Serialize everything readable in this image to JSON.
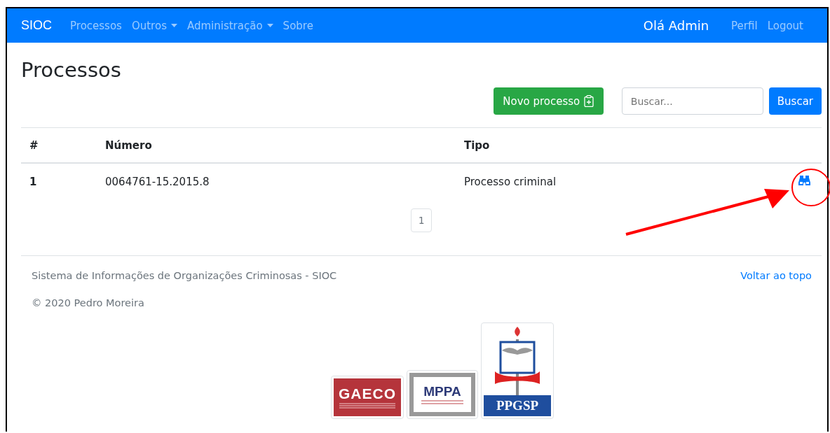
{
  "navbar": {
    "brand": "SIOC",
    "links": [
      {
        "label": "Processos",
        "dropdown": false
      },
      {
        "label": "Outros",
        "dropdown": true
      },
      {
        "label": "Administração",
        "dropdown": true
      },
      {
        "label": "Sobre",
        "dropdown": false
      }
    ],
    "greeting": "Olá Admin",
    "user_links": [
      "Perfil",
      "Logout"
    ]
  },
  "page": {
    "title": "Processos",
    "new_button": "Novo processo",
    "search": {
      "placeholder": "Buscar..."
    },
    "search_button": "Buscar"
  },
  "table": {
    "columns": [
      "#",
      "Número",
      "Tipo"
    ],
    "rows": [
      {
        "index": "1",
        "number": "0064761-15.2015.8",
        "type": "Processo criminal"
      }
    ]
  },
  "pagination": [
    "1"
  ],
  "footer": {
    "system": "Sistema de Informações de Organizações Criminosas - SIOC",
    "back_to_top": "Voltar ao topo",
    "copyright": "© 2020 Pedro Moreira"
  },
  "logos": [
    {
      "kind": "gaeco",
      "name": "GAECO"
    },
    {
      "kind": "mppa",
      "name": "MPPA"
    },
    {
      "kind": "ppgsp",
      "name": "PPGSP"
    }
  ]
}
